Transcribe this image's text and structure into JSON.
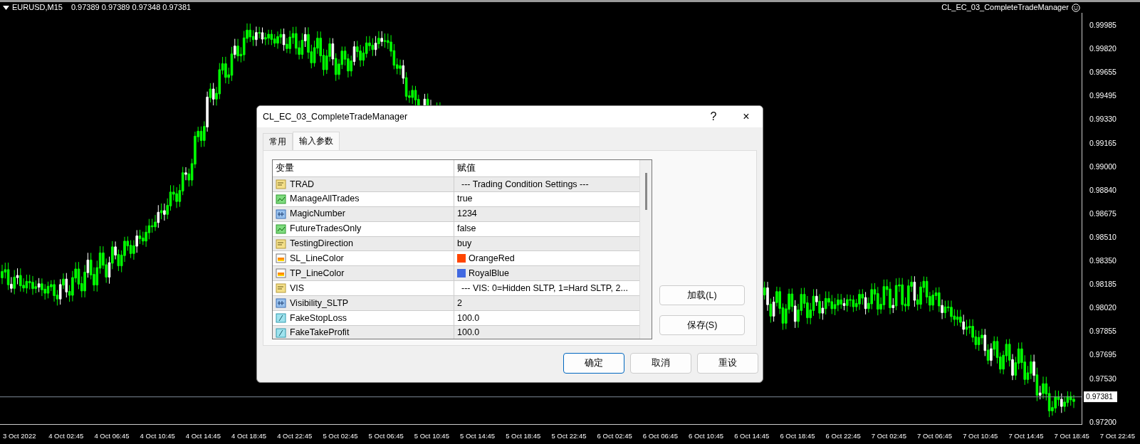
{
  "chart": {
    "header": {
      "symbol": "EURUSD,M15",
      "quotes": "0.97389 0.97389 0.97348 0.97381"
    },
    "expert": {
      "name": "CL_EC_03_CompleteTradeManager"
    },
    "price_axis": {
      "labels": [
        "0.99985",
        "0.99820",
        "0.99655",
        "0.99495",
        "0.99330",
        "0.99165",
        "0.99000",
        "0.98840",
        "0.98675",
        "0.98510",
        "0.98350",
        "0.98185",
        "0.98020",
        "0.97855",
        "0.97695",
        "0.97530",
        "0.97200"
      ],
      "current_price": "0.97381"
    },
    "time_axis": {
      "labels": [
        "3 Oct 2022",
        "4 Oct 02:45",
        "4 Oct 06:45",
        "4 Oct 10:45",
        "4 Oct 14:45",
        "4 Oct 18:45",
        "4 Oct 22:45",
        "5 Oct 02:45",
        "5 Oct 06:45",
        "5 Oct 10:45",
        "5 Oct 14:45",
        "5 Oct 18:45",
        "5 Oct 22:45",
        "6 Oct 02:45",
        "6 Oct 06:45",
        "6 Oct 10:45",
        "6 Oct 14:45",
        "6 Oct 18:45",
        "6 Oct 22:45",
        "7 Oct 02:45",
        "7 Oct 06:45",
        "7 Oct 10:45",
        "7 Oct 14:45",
        "7 Oct 18:45",
        "7 Oct 22:45"
      ]
    }
  },
  "dialog": {
    "title": "CL_EC_03_CompleteTradeManager",
    "help": "?",
    "close": "×",
    "tabs": [
      {
        "label": "常用",
        "selected": false
      },
      {
        "label": "输入参数",
        "selected": true
      }
    ],
    "table": {
      "columns": [
        "变量",
        "赋值"
      ],
      "rows": [
        {
          "kind": "string",
          "name": "TRAD",
          "value": "--- Trading Condition Settings ---"
        },
        {
          "kind": "bool",
          "name": "ManageAllTrades",
          "value": "true"
        },
        {
          "kind": "int",
          "name": "MagicNumber",
          "value": "1234"
        },
        {
          "kind": "bool",
          "name": "FutureTradesOnly",
          "value": "false"
        },
        {
          "kind": "string",
          "name": "TestingDirection",
          "value": "buy"
        },
        {
          "kind": "color",
          "name": "SL_LineColor",
          "value": "OrangeRed",
          "color": "#ff4500"
        },
        {
          "kind": "color",
          "name": "TP_LineColor",
          "value": "RoyalBlue",
          "color": "#4169e1"
        },
        {
          "kind": "string",
          "name": "VIS",
          "value": "--- VIS: 0=Hidden SLTP, 1=Hard SLTP, 2..."
        },
        {
          "kind": "int",
          "name": "Visibility_SLTP",
          "value": "2"
        },
        {
          "kind": "double",
          "name": "FakeStopLoss",
          "value": "100.0"
        },
        {
          "kind": "double",
          "name": "FakeTakeProfit",
          "value": "100.0"
        }
      ]
    },
    "side_buttons": [
      "加载(L)",
      "保存(S)"
    ],
    "buttons": [
      {
        "label": "确定",
        "default": true
      },
      {
        "label": "取消",
        "default": false
      },
      {
        "label": "重设",
        "default": false
      }
    ]
  }
}
